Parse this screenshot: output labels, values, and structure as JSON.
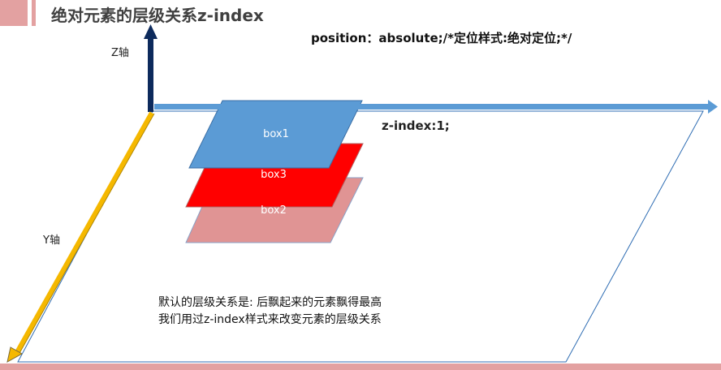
{
  "header": {
    "title": "绝对元素的层级关系z-index"
  },
  "notes": {
    "position_code": "position：absolute;/*定位样式:绝对定位;*/",
    "zindex_code": "z-index:1;"
  },
  "axes": {
    "z_label": "Z轴",
    "y_label": "Y轴"
  },
  "boxes": [
    {
      "label": "box1",
      "color": "#5b9bd5"
    },
    {
      "label": "box3",
      "color": "#ff0000"
    },
    {
      "label": "box2",
      "color": "#e09494"
    }
  ],
  "description": {
    "line1": "默认的层级关系是: 后飘起来的元素飘得最高",
    "line2": "我们用过z-index样式来改变元素的层级关系"
  },
  "colors": {
    "accent": "#e3a1a1",
    "z_axis": "#0d2a5c",
    "x_axis": "#5b9bd5",
    "y_axis": "#f5b800"
  }
}
